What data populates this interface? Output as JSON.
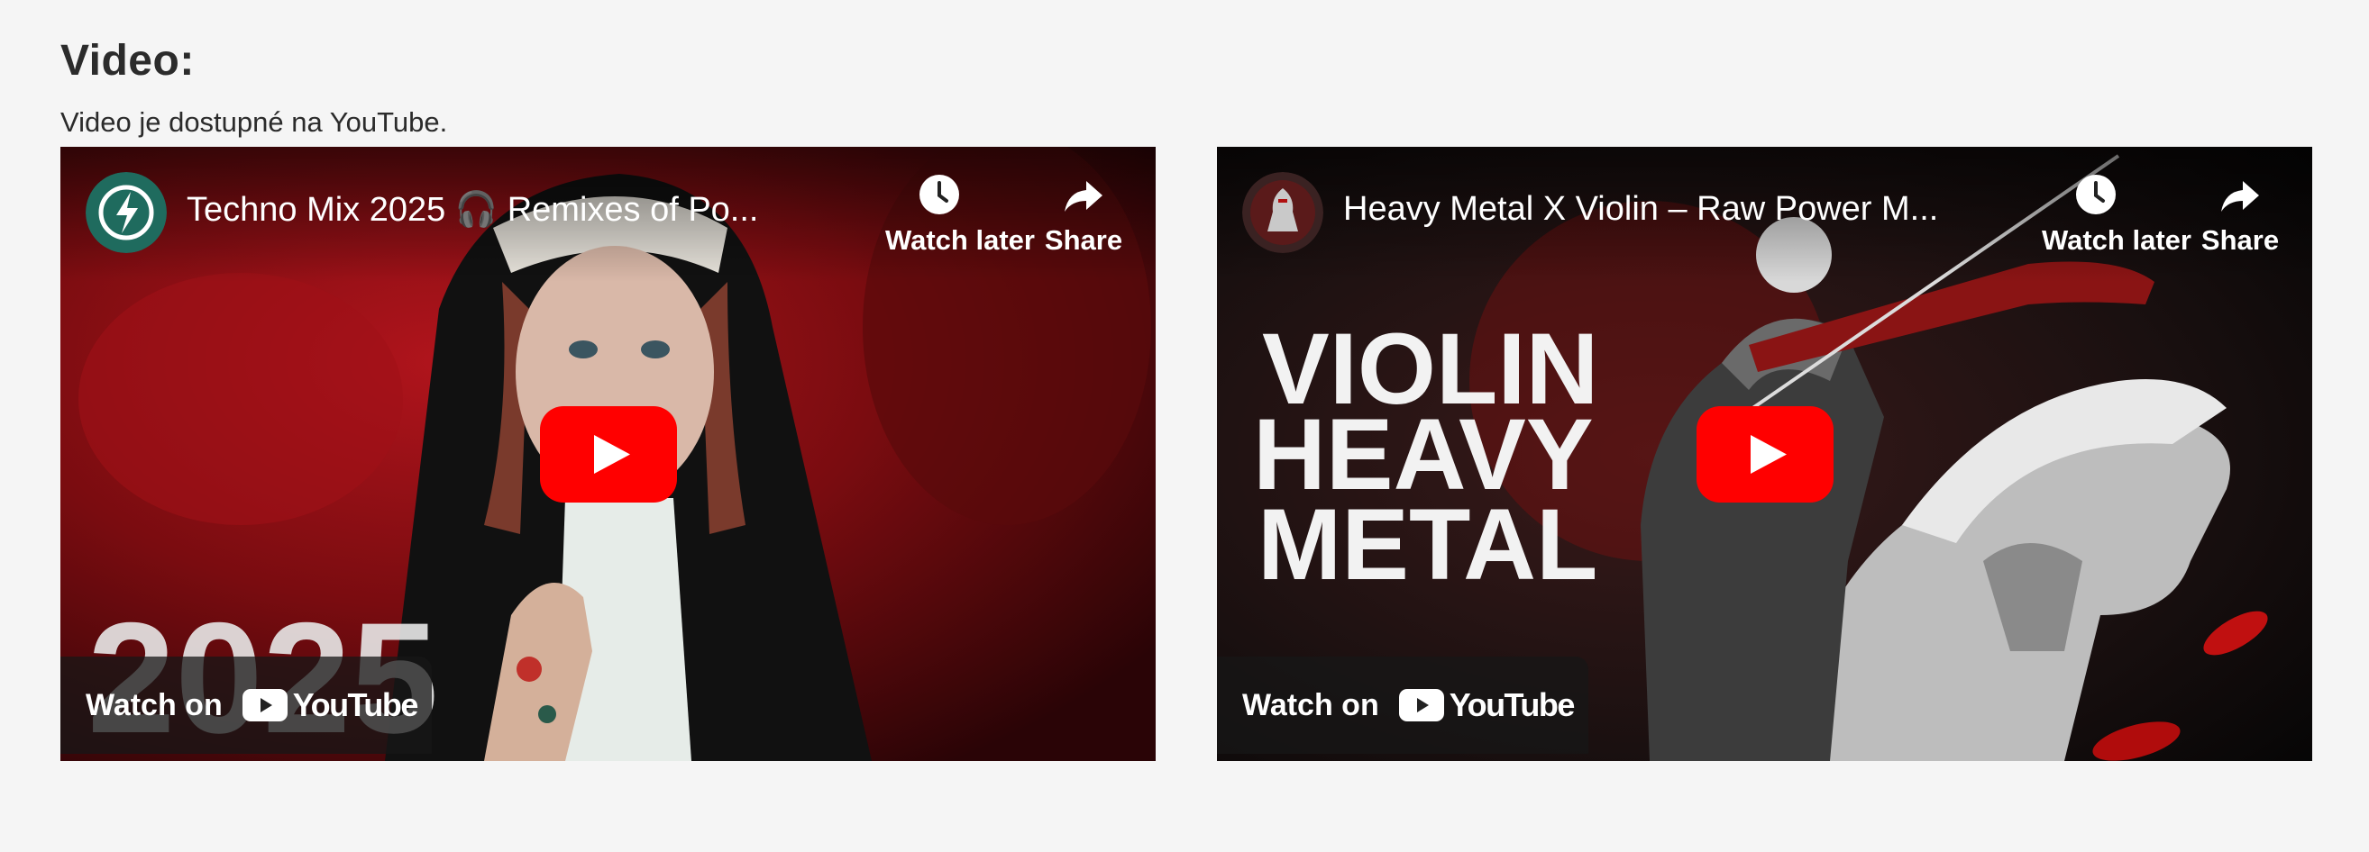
{
  "section": {
    "heading": "Video:",
    "subtext": "Video je dostupné na YouTube."
  },
  "videos": [
    {
      "title": "Techno Mix 2025 🎧 Remixes of Po...",
      "watch_later_label": "Watch later",
      "share_label": "Share",
      "watch_on_label": "Watch on",
      "youtube_label": "YouTube",
      "thumbnail_text": "2025"
    },
    {
      "title": "Heavy Metal X Violin – Raw Power M...",
      "watch_later_label": "Watch later",
      "share_label": "Share",
      "watch_on_label": "Watch on",
      "youtube_label": "YouTube",
      "thumbnail_text": [
        "VIOLIN",
        "HEAVY",
        "METAL"
      ]
    }
  ],
  "colors": {
    "youtube_red": "#ff0000",
    "page_bg": "#f5f5f5",
    "heading": "#2b2b2b"
  },
  "icons": [
    "clock-icon",
    "share-arrow-icon",
    "play-icon",
    "youtube-logo-icon",
    "lightning-channel-icon",
    "knight-channel-icon"
  ]
}
